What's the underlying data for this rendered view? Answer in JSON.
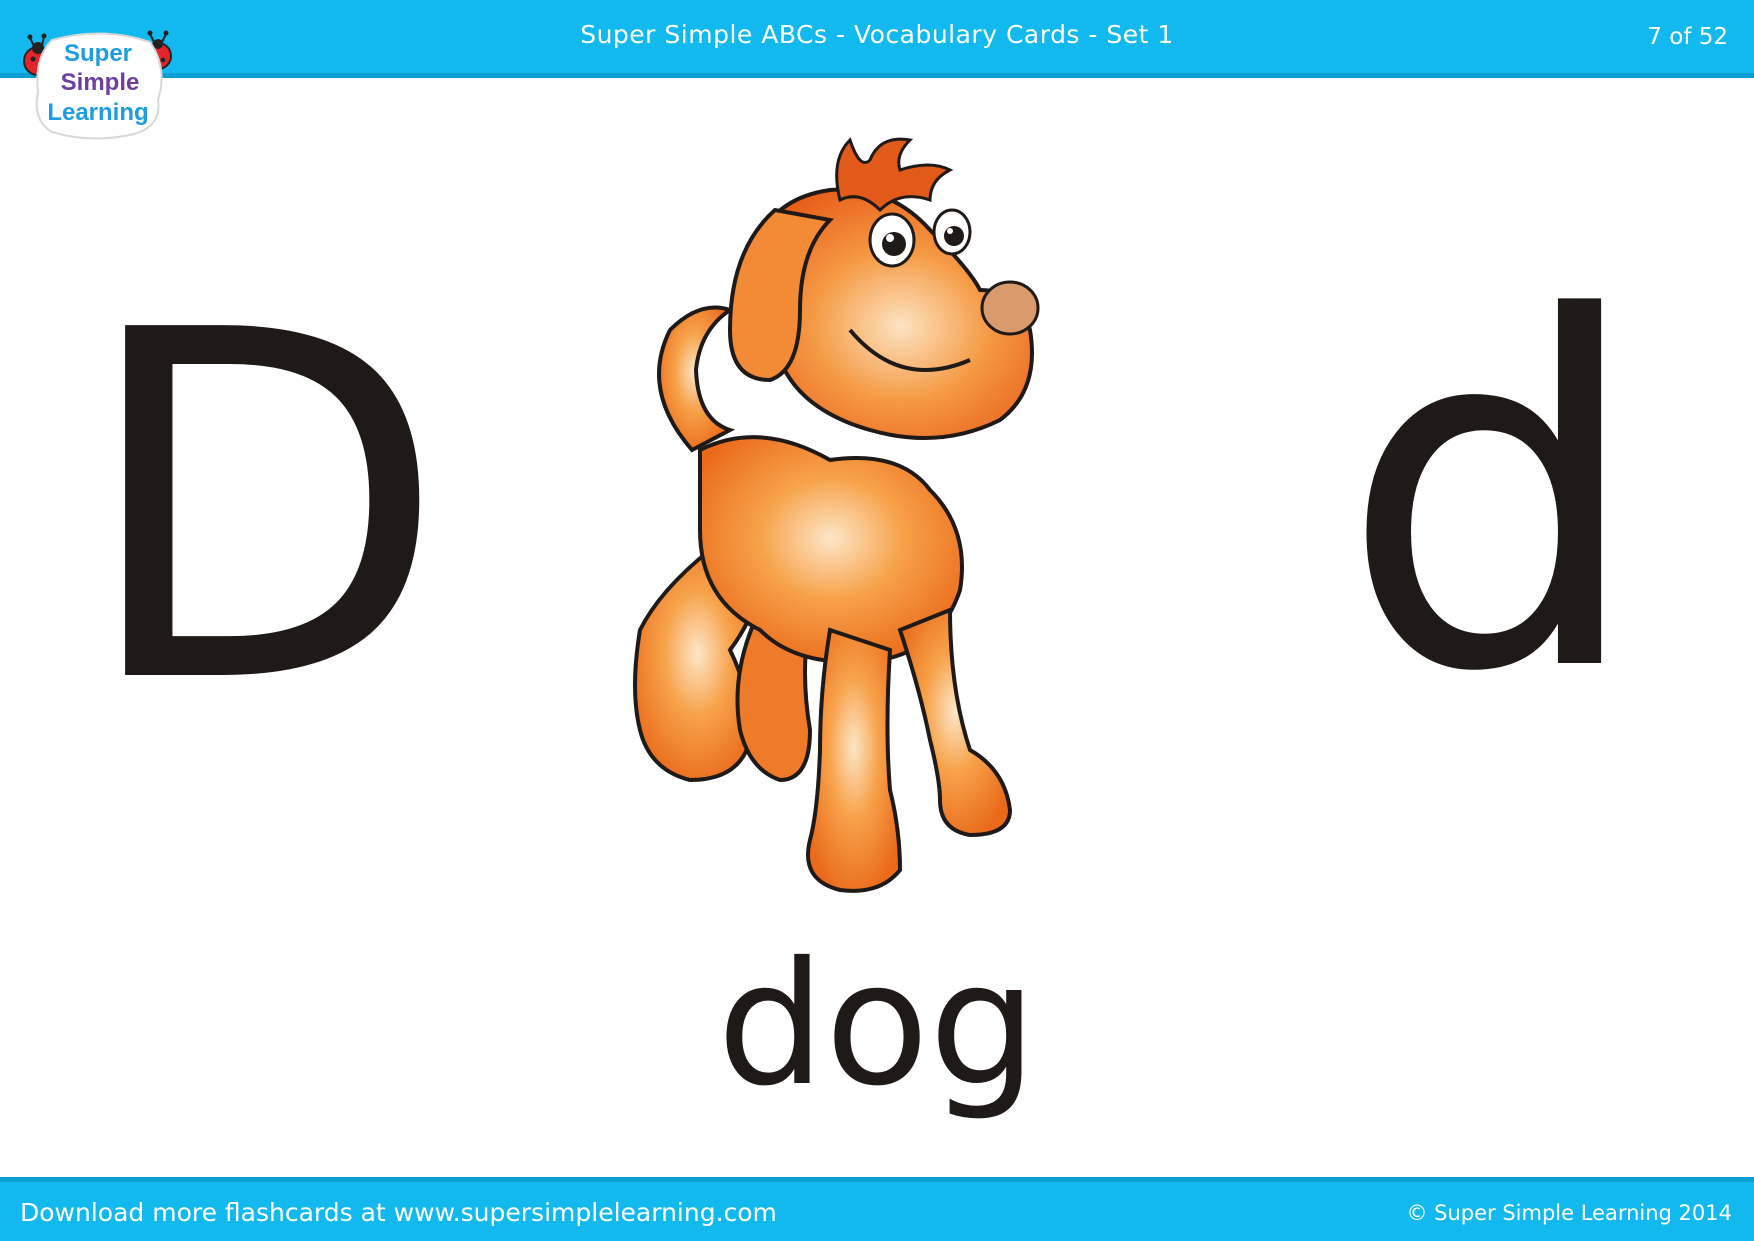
{
  "header": {
    "title": "Super Simple ABCs - Vocabulary Cards - Set 1",
    "page_counter": "7 of 52"
  },
  "logo": {
    "line1": "Super",
    "line2": "Simple",
    "line3": "Learning"
  },
  "card": {
    "uppercase_letter": "D",
    "lowercase_letter": "d",
    "word": "dog",
    "illustration": "dog-illustration"
  },
  "footer": {
    "left_text": "Download more flashcards at www.supersimplelearning.com",
    "right_text": "© Super Simple Learning 2014"
  },
  "colors": {
    "bar": "#12b9ee",
    "bar_accent": "#0a9ed2",
    "text": "#1f1a17",
    "dog_fill": "#f48a2a",
    "dog_nose": "#d99a6c"
  }
}
